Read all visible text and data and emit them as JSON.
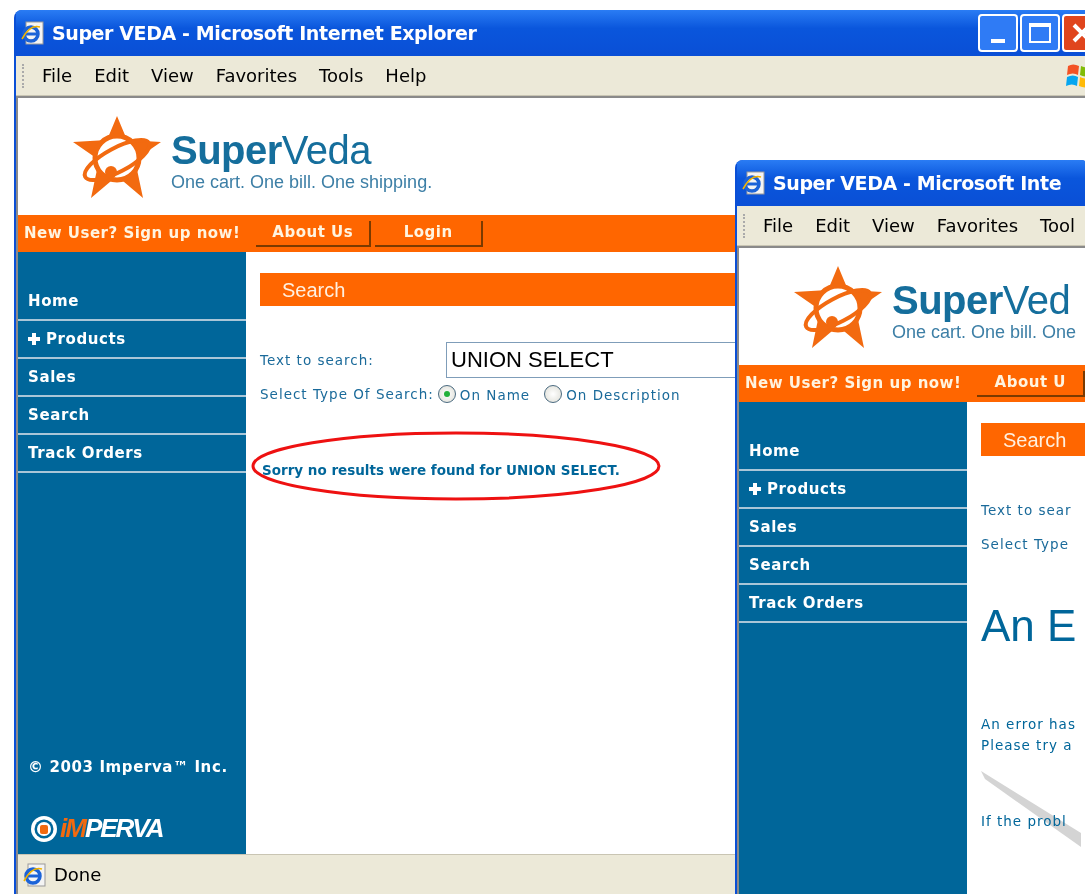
{
  "windows": [
    {
      "title": "Super VEDA - Microsoft Internet Explorer",
      "frame_controls": true,
      "menu": [
        "File",
        "Edit",
        "View",
        "Favorites",
        "Tools",
        "Help"
      ],
      "site": {
        "brand": "**Super**Veda",
        "tagline": "One cart. One bill. One shipping.",
        "signup": "New User? Sign up now!",
        "links": [
          "About Us",
          "Login"
        ],
        "sidebar": [
          {
            "label": "Home",
            "expandable": false
          },
          {
            "label": "Products",
            "expandable": true
          },
          {
            "label": "Sales",
            "expandable": false
          },
          {
            "label": "Search",
            "expandable": false
          },
          {
            "label": "Track Orders",
            "expandable": false
          }
        ],
        "copyright": "© 2003 Imperva™ Inc.",
        "footer_logo": {
          "accent": "iM",
          "rest": "PERVA"
        },
        "section_title": "Search",
        "search": {
          "label": "Text to search:",
          "value": "UNION SELECT",
          "type_label": "Select Type Of Search:",
          "options": [
            {
              "label": "On Name",
              "selected": true
            },
            {
              "label": "On Description",
              "selected": false
            }
          ]
        },
        "message": {
          "text": "Sorry no results were found for UNION SELECT.",
          "circled": true
        }
      },
      "status": "Done"
    },
    {
      "title": "Super VEDA - Microsoft Inte",
      "frame_controls": false,
      "menu": [
        "File",
        "Edit",
        "View",
        "Favorites",
        "Tool"
      ],
      "site": {
        "brand": "**Super**Ved",
        "tagline": "One cart. One bill. One",
        "signup": "New User? Sign up now!",
        "links": [
          "About U"
        ],
        "sidebar": [
          {
            "label": "Home",
            "expandable": false
          },
          {
            "label": "Products",
            "expandable": true
          },
          {
            "label": "Sales",
            "expandable": false
          },
          {
            "label": "Search",
            "expandable": false
          },
          {
            "label": "Track Orders",
            "expandable": false
          }
        ],
        "section_title": "Search",
        "search": {
          "label": "Text to sear",
          "type_label": "Select Type"
        },
        "error": {
          "heading": "An E",
          "lines": [
            "An error has",
            "Please try a"
          ],
          "note": "If the probl"
        }
      }
    }
  ]
}
